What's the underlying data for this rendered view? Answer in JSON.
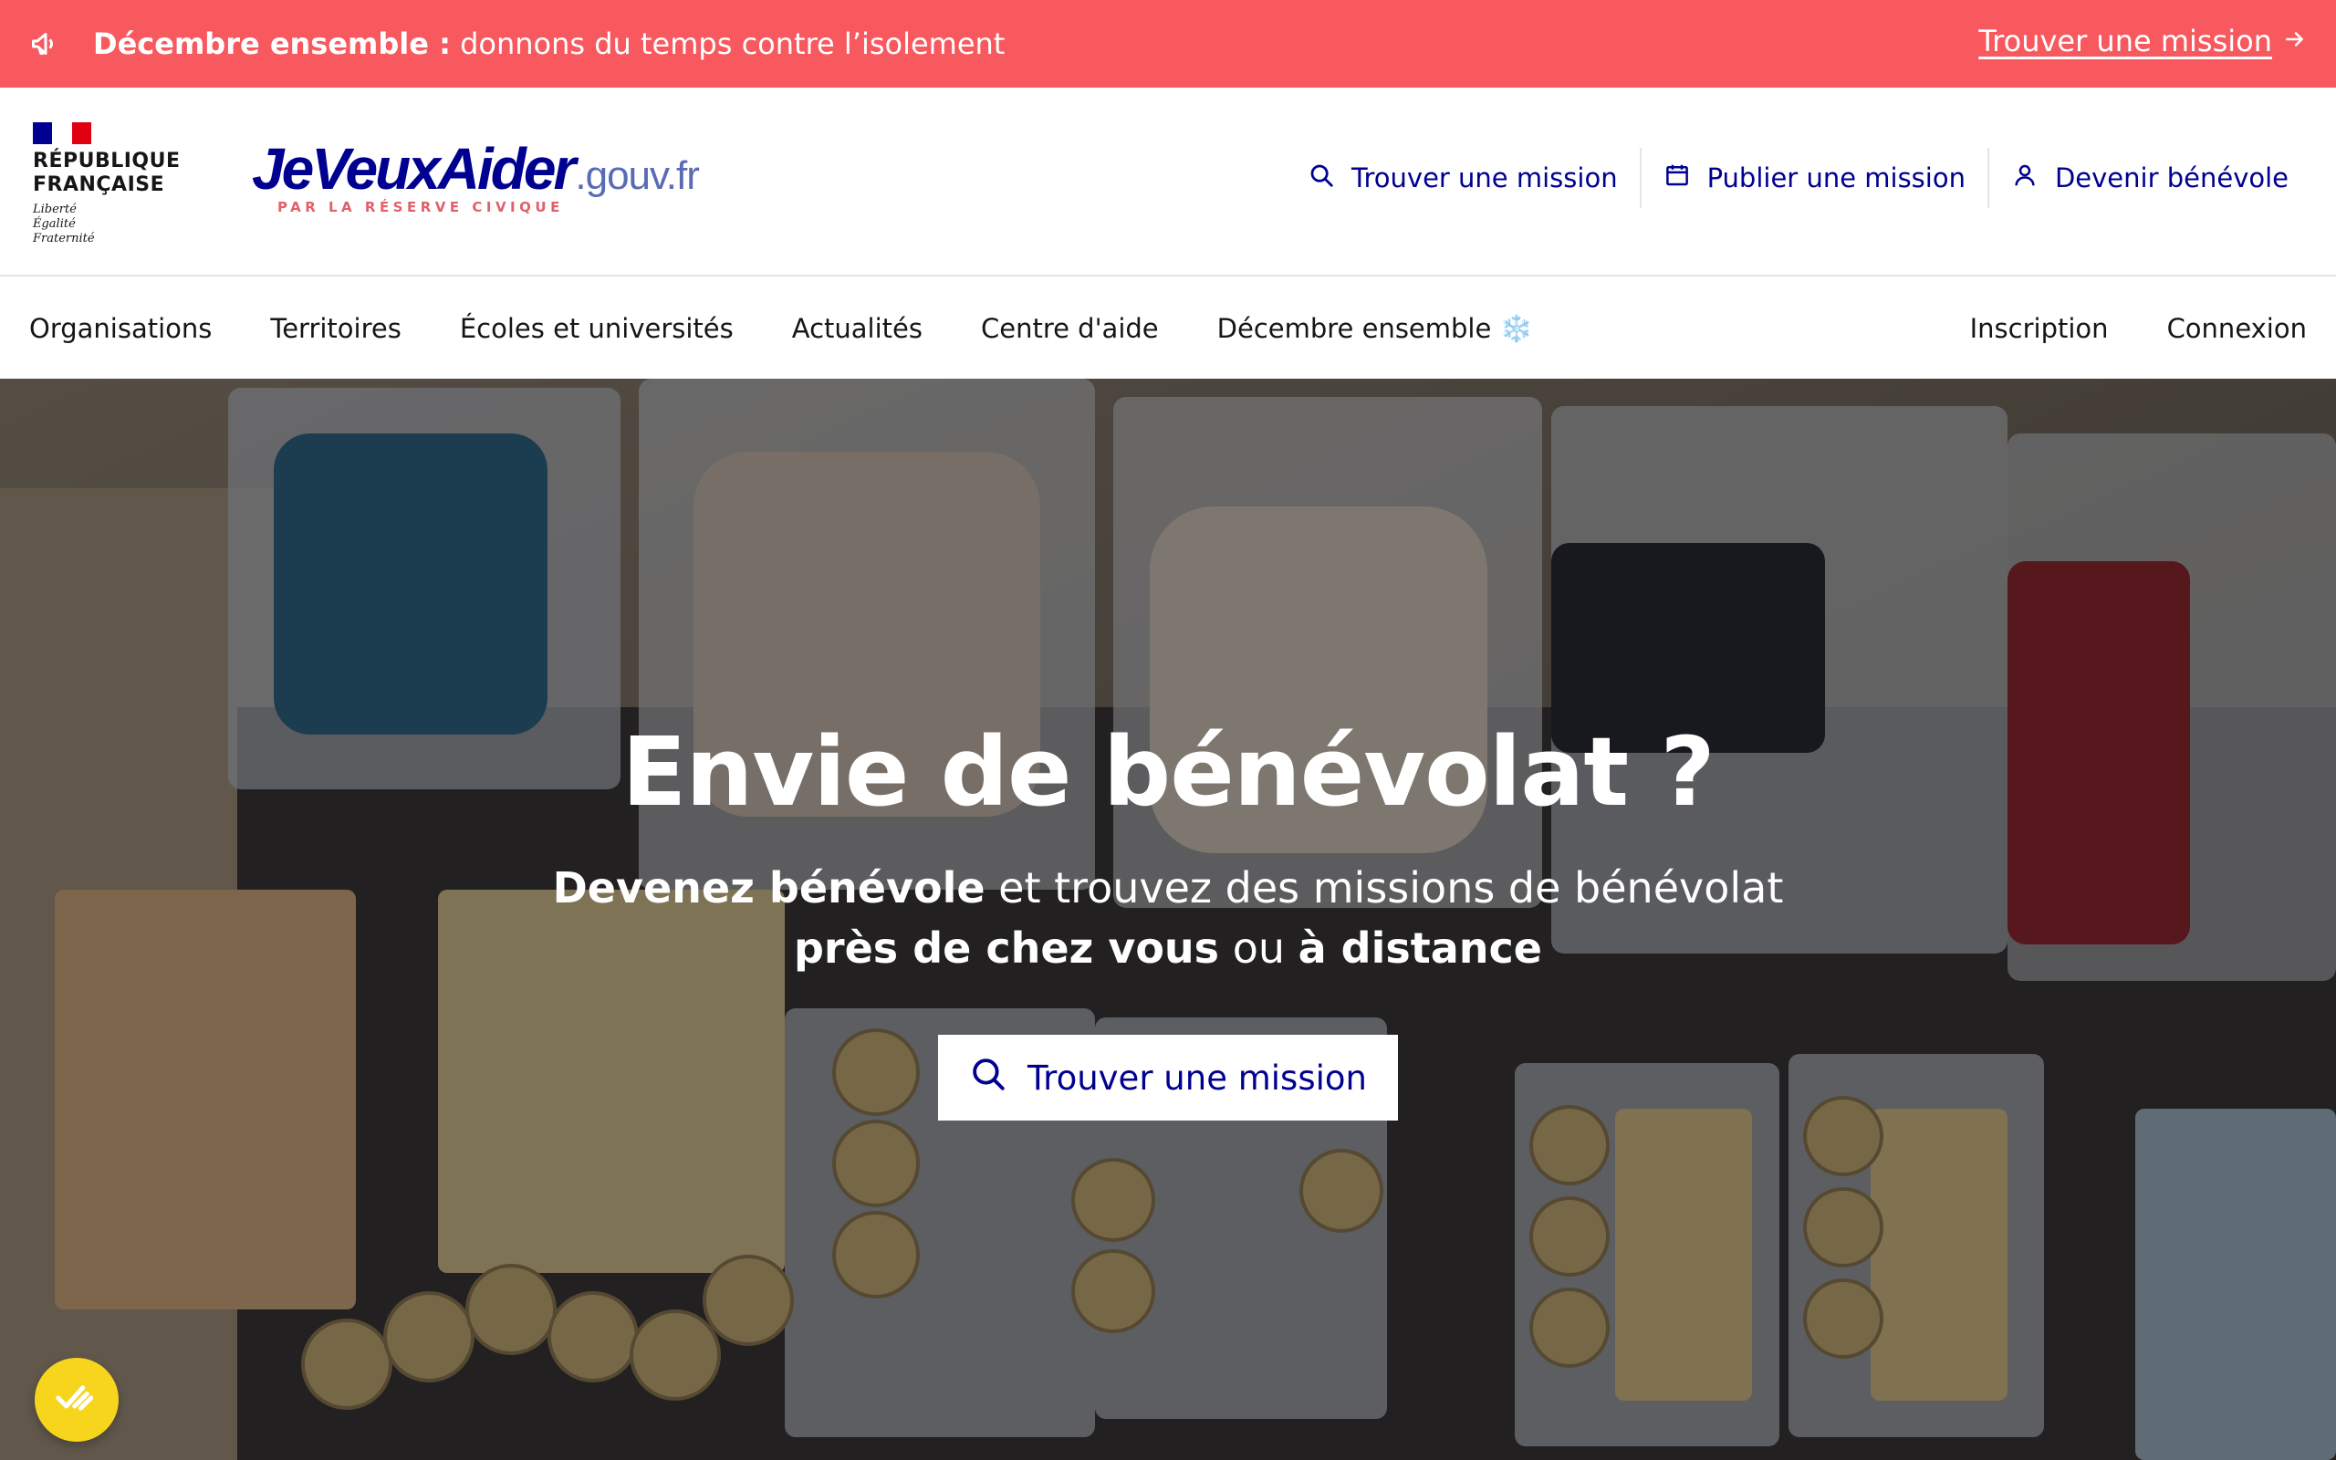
{
  "banner": {
    "bold": "Décembre ensemble :",
    "text": " donnons du temps contre l’isolement",
    "link": "Trouver une mission",
    "icon": "megaphone-icon",
    "color": "#f7595f"
  },
  "header": {
    "republic": {
      "line1": "RÉPUBLIQUE",
      "line2": "FRANÇAISE",
      "motto": [
        "Liberté",
        "Égalité",
        "Fraternité"
      ]
    },
    "brand": {
      "name": "JeVeuxAider",
      "suffix": ".gouv.fr",
      "tagline": "PAR LA RÉSERVE CIVIQUE"
    },
    "quick_links": [
      {
        "label": "Trouver une mission",
        "icon": "search-icon"
      },
      {
        "label": "Publier une mission",
        "icon": "calendar-icon"
      },
      {
        "label": "Devenir bénévole",
        "icon": "user-icon"
      }
    ]
  },
  "nav": {
    "items": [
      "Organisations",
      "Territoires",
      "Écoles et universités",
      "Actualités",
      "Centre d'aide",
      "Décembre ensemble"
    ],
    "snow": "❄️",
    "right": [
      "Inscription",
      "Connexion"
    ]
  },
  "hero": {
    "title": "Envie de bénévolat ?",
    "sub1_bold": "Devenez bénévole",
    "sub1_rest": " et trouvez des missions de bénévolat",
    "sub2_bold1": "près de chez vous",
    "sub2_mid": " ou ",
    "sub2_bold2": "à distance",
    "cta": "Trouver une mission"
  },
  "colors": {
    "primary": "#000091",
    "banner": "#f7595f",
    "badge": "#f7d51d"
  }
}
